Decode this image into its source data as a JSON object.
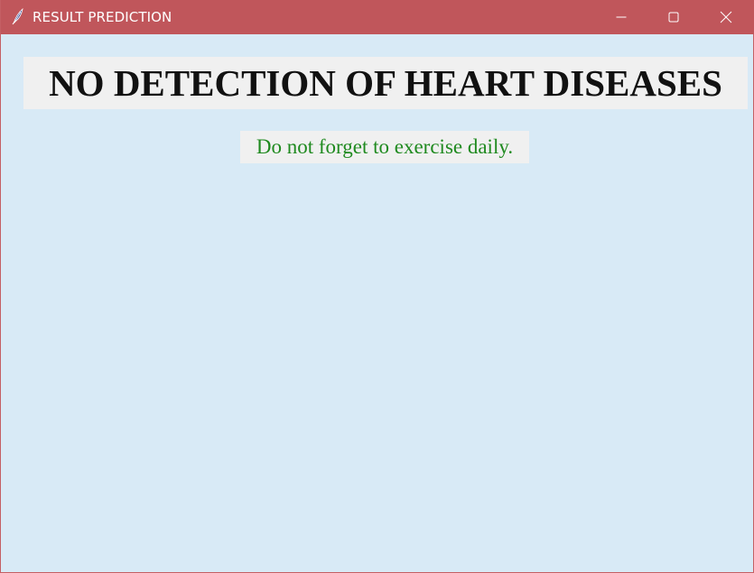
{
  "window": {
    "title": "RESULT PREDICTION",
    "app_icon": "feather-icon",
    "controls": [
      "minimize-icon",
      "maximize-icon",
      "close-icon"
    ],
    "titlebar_color": "#c0565b",
    "background_color": "#d8eaf6"
  },
  "result": {
    "heading": "NO DETECTION OF HEART DISEASES",
    "message": "Do not forget to exercise daily.",
    "message_color": "#1f8a1f"
  }
}
